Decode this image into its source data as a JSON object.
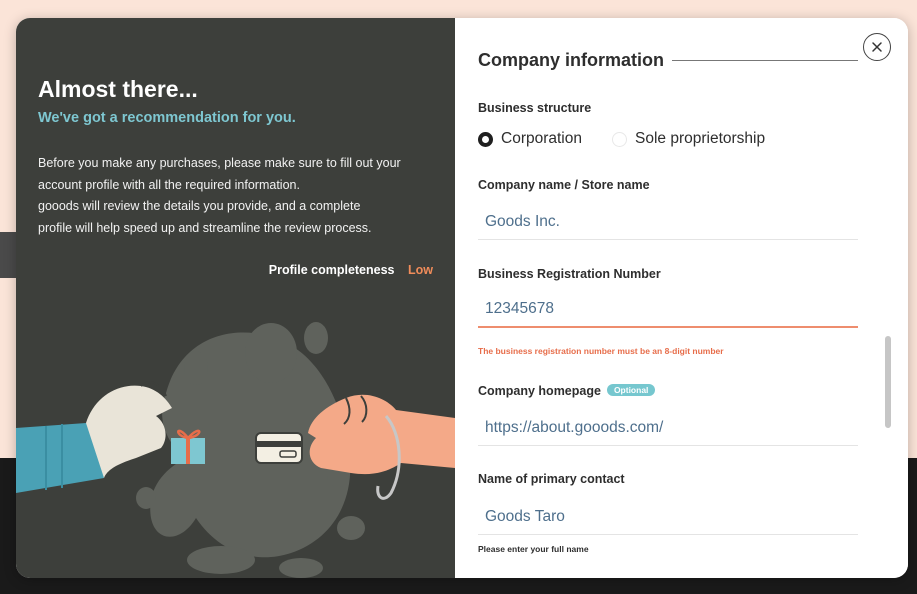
{
  "left": {
    "title": "Almost there...",
    "subtitle": "We've got a recommendation for you.",
    "body_lines": [
      "Before you make any purchases, please make sure to fill out your",
      "account profile with all the required information.",
      "gooods will review the details you provide, and a complete",
      "profile will help speed up and streamline the review process."
    ],
    "completeness_label": "Profile completeness",
    "completeness_value": "Low"
  },
  "form": {
    "section_title": "Company information",
    "business_structure": {
      "label": "Business structure",
      "options": [
        "Corporation",
        "Sole proprietorship"
      ],
      "selected": "Corporation"
    },
    "company_name": {
      "label": "Company name / Store name",
      "value": "Goods Inc."
    },
    "registration_number": {
      "label": "Business Registration Number",
      "value": "12345678",
      "error": "The business registration number must be an 8-digit number"
    },
    "homepage": {
      "label": "Company homepage",
      "badge": "Optional",
      "value": "https://about.gooods.com/"
    },
    "primary_contact": {
      "label": "Name of primary contact",
      "value": "Goods Taro",
      "hint": "Please enter your full name"
    }
  },
  "colors": {
    "left_panel": "#3d3f3b",
    "accent_teal": "#7ec7d1",
    "accent_orange": "#f08c5a",
    "error": "#e76d4a"
  },
  "icons": {
    "close": "close-icon",
    "card": "credit-card-icon",
    "gift": "gift-box-icon"
  }
}
